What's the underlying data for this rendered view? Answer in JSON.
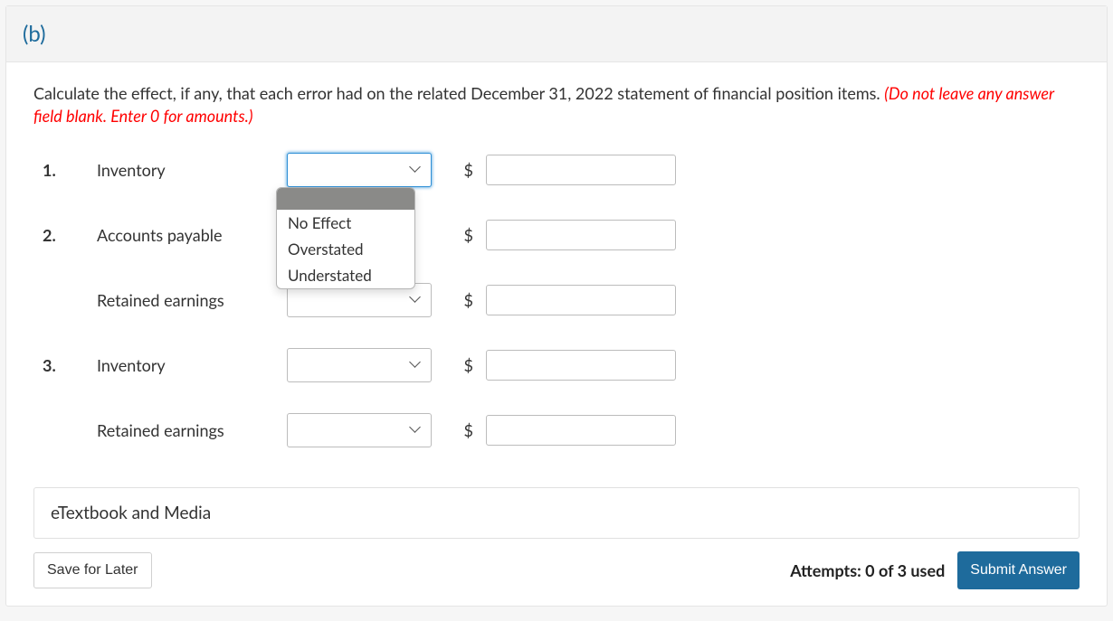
{
  "part_label": "(b)",
  "instruction": {
    "main": "Calculate the effect, if any, that each error had on the related December 31, 2022 statement of financial position items. ",
    "warn": "(Do not leave any answer field blank. Enter 0 for amounts.)"
  },
  "currency_symbol": "$",
  "rows": [
    {
      "num": "1.",
      "label": "Inventory",
      "dropdown_open": true
    },
    {
      "num": "2.",
      "label": "Accounts payable",
      "dropdown_open": false
    },
    {
      "num": "",
      "label": "Retained earnings",
      "dropdown_open": false
    },
    {
      "num": "3.",
      "label": "Inventory",
      "dropdown_open": false
    },
    {
      "num": "",
      "label": "Retained earnings",
      "dropdown_open": false
    }
  ],
  "dropdown_options": [
    "",
    "No Effect",
    "Overstated",
    "Understated"
  ],
  "etextbook_label": "eTextbook and Media",
  "save_label": "Save for Later",
  "attempts_text": "Attempts: 0 of 3 used",
  "submit_label": "Submit Answer"
}
